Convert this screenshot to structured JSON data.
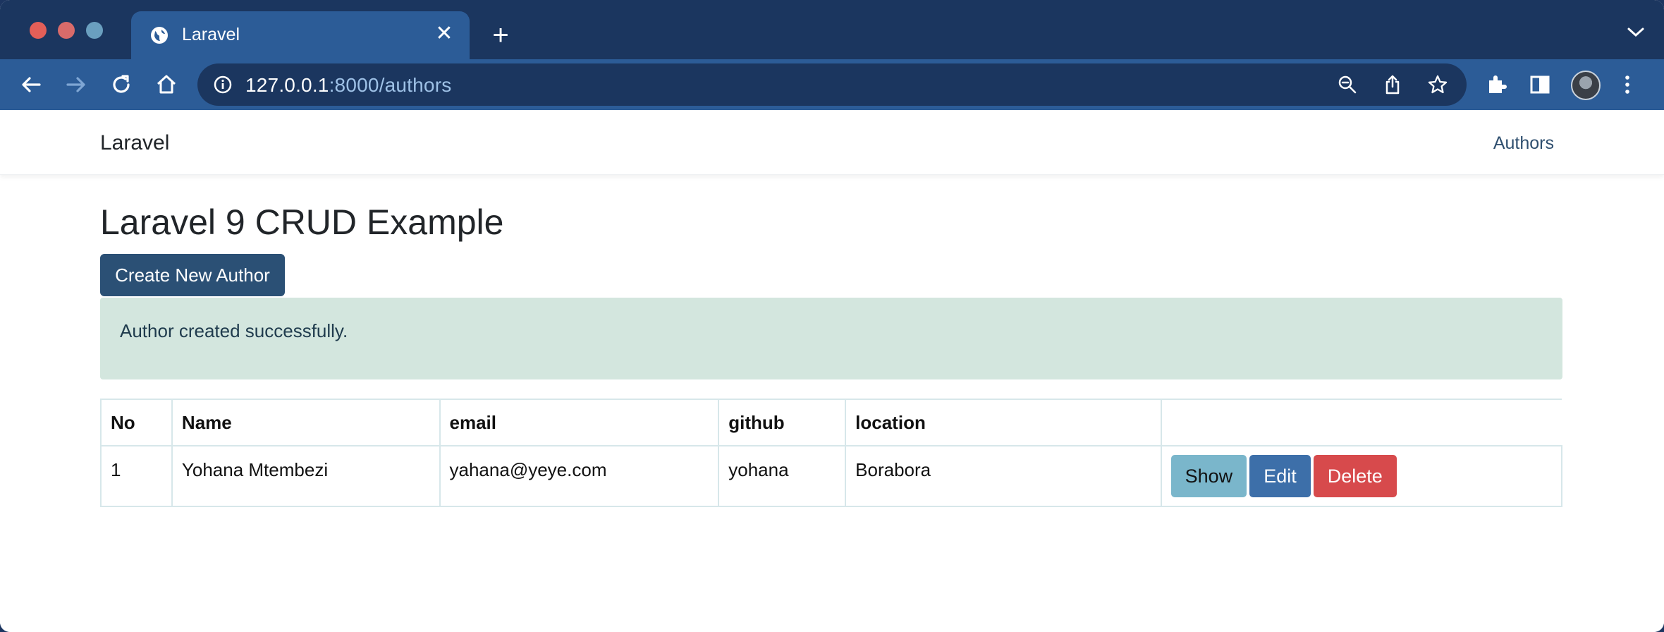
{
  "browser": {
    "tab_title": "Laravel",
    "new_tab": "+",
    "close": "✕",
    "url_host": "127.0.0.1",
    "url_path": ":8000/authors"
  },
  "navbar": {
    "brand": "Laravel",
    "link": "Authors"
  },
  "main": {
    "heading": "Laravel 9 CRUD Example",
    "create_button": "Create New Author",
    "alert": "Author created successfully."
  },
  "table": {
    "headers": [
      "No",
      "Name",
      "email",
      "github",
      "location",
      ""
    ],
    "rows": [
      {
        "no": "1",
        "name": "Yohana Mtembezi",
        "email": "yahana@yeye.com",
        "github": "yohana",
        "location": "Borabora",
        "actions": {
          "show": "Show",
          "edit": "Edit",
          "delete": "Delete"
        }
      }
    ]
  },
  "colors": {
    "tabstrip": "#1b365f",
    "toolbar": "#2c5c97",
    "primary_button": "#2b5075",
    "alert_bg": "#d3e6de",
    "show_button": "#7ab6cb",
    "edit_button": "#3d6fa9",
    "delete_button": "#d74a4c"
  },
  "icons": [
    "back-arrow-icon",
    "forward-arrow-icon",
    "reload-icon",
    "home-icon",
    "info-icon",
    "zoom-out-icon",
    "share-icon",
    "star-icon",
    "extensions-icon",
    "side-panel-icon",
    "menu-kebab-icon",
    "globe-icon",
    "chevron-down-icon"
  ]
}
